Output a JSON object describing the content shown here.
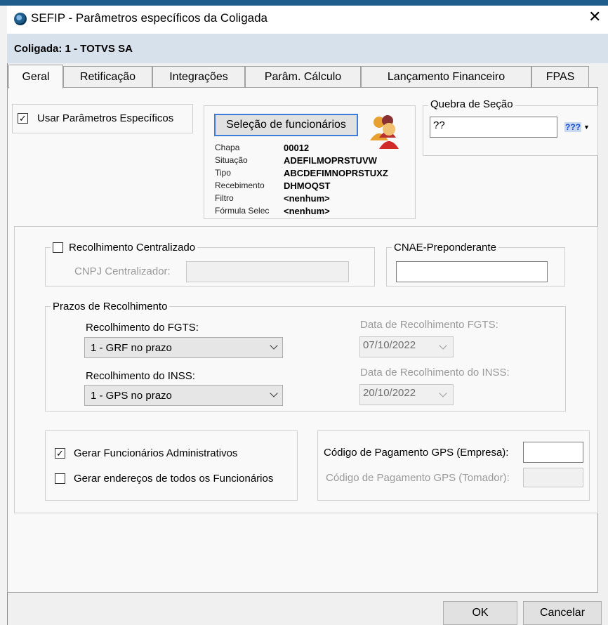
{
  "window": {
    "title": "SEFIP - Parâmetros específicos da Coligada",
    "close_icon": "close-icon",
    "app_icon": "app-globe-icon"
  },
  "header": {
    "coligada": "Coligada: 1 - TOTVS SA"
  },
  "tabs": [
    {
      "label": "Geral",
      "active": true
    },
    {
      "label": "Retificação"
    },
    {
      "label": "Integrações"
    },
    {
      "label": "Parâm. Cálculo"
    },
    {
      "label": "Lançamento Financeiro"
    },
    {
      "label": "FPAS"
    }
  ],
  "geral": {
    "usar_parametros": {
      "label": "Usar Parâmetros Específicos",
      "checked": true
    },
    "selecao": {
      "button_label": "Seleção de funcionários",
      "icon": "users-group-icon",
      "rows": [
        {
          "key": "Chapa",
          "value": "00012"
        },
        {
          "key": "Situação",
          "value": "ADEFILMOPRSTUVW"
        },
        {
          "key": "Tipo",
          "value": "ABCDEFIMNOPRSTUXZ"
        },
        {
          "key": "Recebimento",
          "value": "DHMOQST"
        },
        {
          "key": "Filtro",
          "value": "<nenhum>"
        },
        {
          "key": "Fórmula Selec",
          "value": "<nenhum>"
        }
      ]
    },
    "quebra_secao": {
      "legend": "Quebra de Seção",
      "value": "??",
      "lookup_label": "???"
    },
    "recolhimento_centralizado": {
      "label": "Recolhimento Centralizado",
      "checked": false,
      "cnpj_label": "CNPJ Centralizador:",
      "cnpj_value": ""
    },
    "cnae": {
      "legend": "CNAE-Preponderante",
      "value": ""
    },
    "prazos": {
      "legend": "Prazos de Recolhimento",
      "fgts_label": "Recolhimento do FGTS:",
      "fgts_value": "1 - GRF no prazo",
      "inss_label": "Recolhimento do INSS:",
      "inss_value": "1 - GPS no prazo",
      "data_fgts_label": "Data de Recolhimento FGTS:",
      "data_fgts_value": "07/10/2022",
      "data_inss_label": "Data de Recolhimento do INSS:",
      "data_inss_value": "20/10/2022"
    },
    "gerar_admin": {
      "label": "Gerar Funcionários Administrativos",
      "checked": true
    },
    "gerar_enderecos": {
      "label": "Gerar endereços de todos os Funcionários",
      "checked": false
    },
    "gps_empresa": {
      "label": "Código de Pagamento GPS (Empresa):",
      "value": ""
    },
    "gps_tomador": {
      "label": "Código de Pagamento GPS (Tomador):",
      "value": ""
    }
  },
  "footer": {
    "ok_label": "OK",
    "cancel_label": "Cancelar"
  },
  "colors": {
    "title_band": "#d7e1ec",
    "panel": "#f9f9f9",
    "app_strip": "#1f5e8c"
  }
}
